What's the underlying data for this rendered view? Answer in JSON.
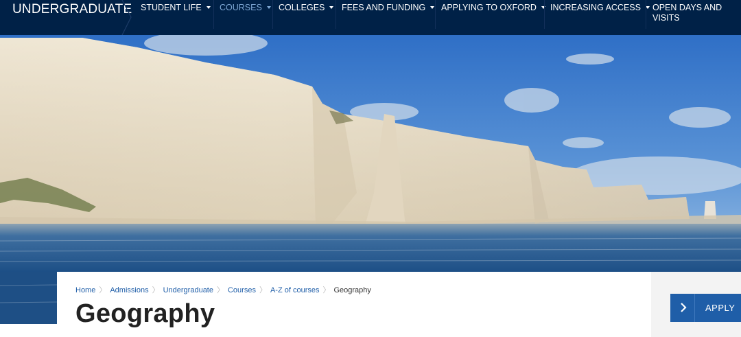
{
  "site": {
    "section_title": "UNDERGRADUATE"
  },
  "nav": {
    "items": [
      {
        "label": "STUDENT LIFE",
        "has_dropdown": true,
        "active": false
      },
      {
        "label": "COURSES",
        "has_dropdown": true,
        "active": true
      },
      {
        "label": "COLLEGES",
        "has_dropdown": true,
        "active": false
      },
      {
        "label": "FEES AND FUNDING",
        "has_dropdown": true,
        "active": false
      },
      {
        "label": "APPLYING TO OXFORD",
        "has_dropdown": true,
        "active": false
      },
      {
        "label": "INCREASING ACCESS",
        "has_dropdown": true,
        "active": false
      },
      {
        "label": "OPEN DAYS AND VISITS",
        "has_dropdown": false,
        "active": false
      }
    ]
  },
  "breadcrumb": [
    {
      "label": "Home",
      "link": true
    },
    {
      "label": "Admissions",
      "link": true
    },
    {
      "label": "Undergraduate",
      "link": true
    },
    {
      "label": "Courses",
      "link": true
    },
    {
      "label": "A-Z of courses",
      "link": true
    },
    {
      "label": "Geography",
      "link": false
    }
  ],
  "page": {
    "title": "Geography"
  },
  "apply": {
    "label": "APPLY"
  },
  "icons": {
    "dropdown": "caret-down-icon",
    "apply": "chevron-right-icon",
    "breadcrumb_sep": "chevron-separator-icon"
  },
  "colors": {
    "nav_bg": "#002147",
    "nav_active": "#7fa9d6",
    "link": "#1f5ea8",
    "apply_bg": "#1f5ea8",
    "side_panel": "#f3f3f3"
  }
}
